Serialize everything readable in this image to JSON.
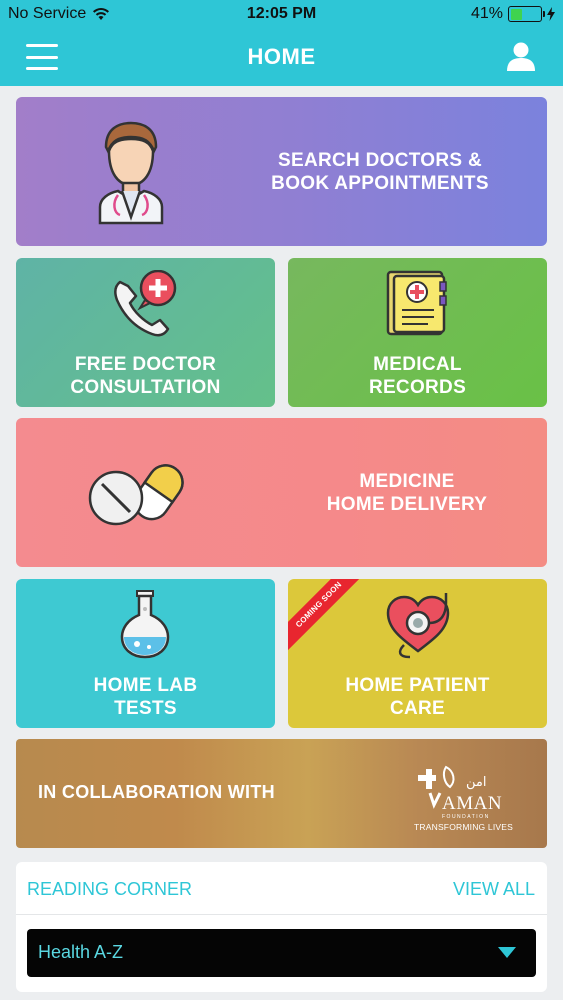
{
  "status_bar": {
    "carrier": "No Service",
    "time": "12:05 PM",
    "battery_pct": "41%",
    "battery_level": 0.41
  },
  "nav": {
    "title": "HOME"
  },
  "tiles": {
    "search": {
      "line1": "SEARCH DOCTORS &",
      "line2": "BOOK APPOINTMENTS",
      "icon": "doctor-icon"
    },
    "consult": {
      "line1": "FREE DOCTOR",
      "line2": "CONSULTATION",
      "icon": "phone-consult-icon"
    },
    "records": {
      "line1": "MEDICAL",
      "line2": "RECORDS",
      "icon": "medical-folder-icon"
    },
    "medicine": {
      "line1": "MEDICINE",
      "line2": "HOME DELIVERY",
      "icon": "pills-icon"
    },
    "lab": {
      "line1": "HOME LAB",
      "line2": "TESTS",
      "icon": "flask-icon"
    },
    "care": {
      "line1": "HOME PATIENT",
      "line2": "CARE",
      "badge": "COMING SOON",
      "icon": "heart-stethoscope-icon"
    },
    "collab": {
      "label": "IN COLLABORATION WITH",
      "logo_arabic": "امن",
      "logo_name": "AMAN",
      "logo_sub": "FOUNDATION",
      "logo_tagline": "TRANSFORMING LIVES"
    }
  },
  "reading_corner": {
    "heading": "READING CORNER",
    "view_all": "VIEW ALL",
    "selected": "Health A-Z"
  },
  "colors": {
    "accent": "#2ec6d6",
    "badge_red": "#e8262f"
  }
}
